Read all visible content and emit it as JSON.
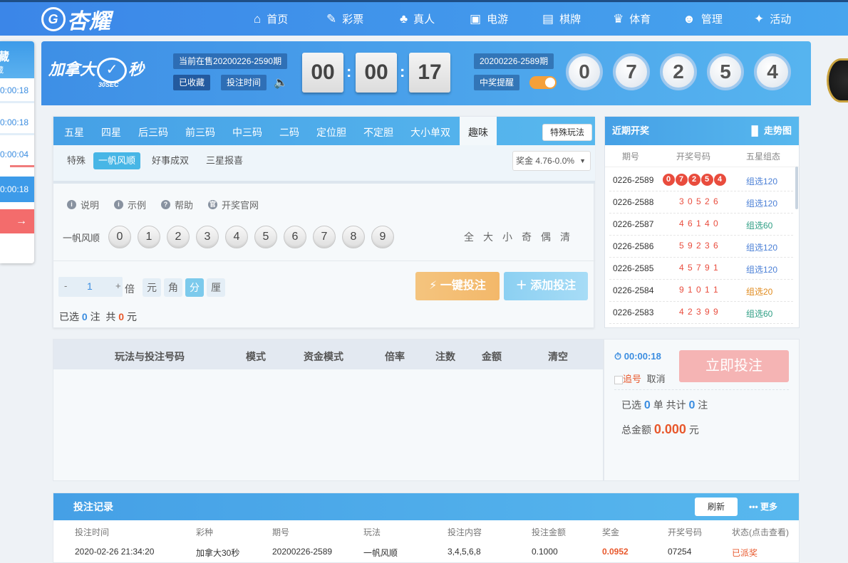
{
  "nav": {
    "brand": "杏耀",
    "items": [
      {
        "label": "首页",
        "icon": "home-icon",
        "glyph": "⌂"
      },
      {
        "label": "彩票",
        "icon": "lottery-ticket-icon",
        "glyph": "✎"
      },
      {
        "label": "真人",
        "icon": "live-dealer-icon",
        "glyph": "♣"
      },
      {
        "label": "电游",
        "icon": "slot-machine-icon",
        "glyph": "▣"
      },
      {
        "label": "棋牌",
        "icon": "cards-icon",
        "glyph": "▤"
      },
      {
        "label": "体育",
        "icon": "trophy-icon",
        "glyph": "♛"
      },
      {
        "label": "管理",
        "icon": "users-icon",
        "glyph": "☻"
      },
      {
        "label": "活动",
        "icon": "gift-icon",
        "glyph": "✦"
      }
    ]
  },
  "left_panel": {
    "title": "藏",
    "subtitle": "藏",
    "rows": [
      "0:00:18",
      "0:00:18",
      "0:00:04",
      "0:00:18"
    ],
    "arrow": "→"
  },
  "header": {
    "game_name": "加拿大",
    "game_badge": "秒",
    "game_sub": "30SEC",
    "current_period": "当前在售20200226-2590期",
    "favorited": "已收藏",
    "bet_time": "投注时间",
    "countdown": [
      "00",
      "00",
      "17"
    ],
    "last_period": "20200226-2589期",
    "win_alert": "中奖提醒",
    "balls": [
      "0",
      "7",
      "2",
      "5",
      "4"
    ]
  },
  "play": {
    "tabs": [
      "五星",
      "四星",
      "后三码",
      "前三码",
      "中三码",
      "二码",
      "定位胆",
      "不定胆",
      "大小单双",
      "趣味"
    ],
    "special_btn": "特殊玩法",
    "subtabs": [
      "特殊",
      "一帆风顺",
      "好事成双",
      "三星报喜"
    ],
    "bonus": "奖金 4.76-0.0%",
    "help": [
      {
        "label": "说明",
        "icon": "info-icon",
        "glyph": "i"
      },
      {
        "label": "示例",
        "icon": "example-icon",
        "glyph": "i"
      },
      {
        "label": "帮助",
        "icon": "help-icon",
        "glyph": "?"
      },
      {
        "label": "开奖官网",
        "icon": "official-site-icon",
        "glyph": "官"
      }
    ],
    "row_label": "一帆风顺",
    "numbers": [
      "0",
      "1",
      "2",
      "3",
      "4",
      "5",
      "6",
      "7",
      "8",
      "9"
    ],
    "quick": [
      "全",
      "大",
      "小",
      "奇",
      "偶",
      "清"
    ],
    "multiple": "1",
    "multiple_unit": "倍",
    "units": [
      "元",
      "角",
      "分",
      "厘"
    ],
    "one_key": "一键投注",
    "add_bet": "添加投注",
    "selected_prefix": "已选",
    "selected_count": "0",
    "selected_unit": "注",
    "total_prefix": "共",
    "total_amount": "0",
    "total_unit": "元"
  },
  "recent": {
    "title": "近期开奖",
    "trend": "走势图",
    "headers": [
      "期号",
      "开奖号码",
      "五星组态"
    ],
    "rows": [
      {
        "period": "0226-2589",
        "nums": [
          "0",
          "7",
          "2",
          "5",
          "4"
        ],
        "type": "组选120",
        "color": "#4a7fd6"
      },
      {
        "period": "0226-2588",
        "nums": "3 0 5 2 6",
        "type": "组选120",
        "color": "#4a7fd6"
      },
      {
        "period": "0226-2587",
        "nums": "4 6 1 4 0",
        "type": "组选60",
        "color": "#2e9e84"
      },
      {
        "period": "0226-2586",
        "nums": "5 9 2 3 6",
        "type": "组选120",
        "color": "#4a7fd6"
      },
      {
        "period": "0226-2585",
        "nums": "4 5 7 9 1",
        "type": "组选120",
        "color": "#4a7fd6"
      },
      {
        "period": "0226-2584",
        "nums": "9 1 0 1 1",
        "type": "组选20",
        "color": "#e08a1c"
      },
      {
        "period": "0226-2583",
        "nums": "4 2 3 9 9",
        "type": "组选60",
        "color": "#2e9e84"
      }
    ]
  },
  "betlist": {
    "headers": [
      "玩法与投注号码",
      "模式",
      "资金模式",
      "倍率",
      "注数",
      "金额",
      "清空"
    ]
  },
  "submit": {
    "timer": "00:00:18",
    "chase": "追号",
    "cancel": "取消",
    "button": "立即投注",
    "sel_prefix": "已选",
    "sel_count": "0",
    "sel_mid": "单 共计",
    "sel_bets": "0",
    "sel_suffix": "注",
    "total_label": "总金额",
    "total_value": "0.000",
    "total_unit": "元"
  },
  "records": {
    "title": "投注记录",
    "refresh": "刷新",
    "more": "更多",
    "headers": [
      "投注时间",
      "彩种",
      "期号",
      "玩法",
      "投注内容",
      "投注金额",
      "奖金",
      "开奖号码",
      "状态(点击查看)"
    ],
    "row": [
      "2020-02-26 21:34:20",
      "加拿大30秒",
      "20200226-2589",
      "一帆风顺",
      "3,4,5,6,8",
      "0.1000",
      "0.0952",
      "07254",
      "已派奖"
    ]
  }
}
